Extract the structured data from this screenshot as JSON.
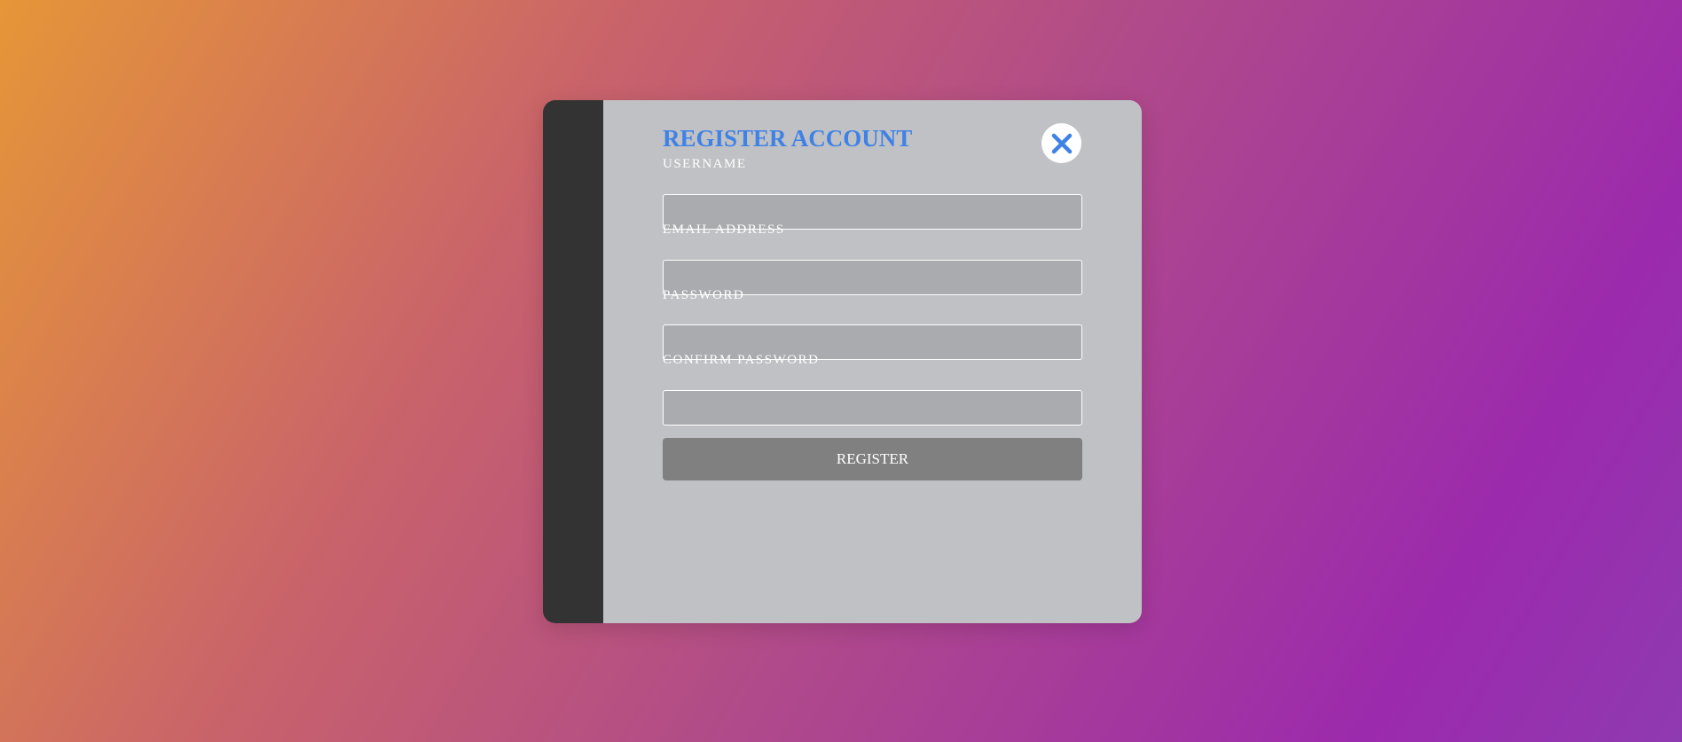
{
  "form": {
    "title": "REGISTER ACCOUNT",
    "fields": [
      {
        "label": "USERNAME",
        "value": "",
        "placeholder": ""
      },
      {
        "label": "EMAIL ADDRESS",
        "value": "",
        "placeholder": ""
      },
      {
        "label": "PASSWORD",
        "value": "",
        "placeholder": ""
      },
      {
        "label": "CONFIRM PASSWORD",
        "value": "",
        "placeholder": ""
      }
    ],
    "submit_label": "REGISTER",
    "close_icon": "close-icon"
  },
  "colors": {
    "accent": "#3f82e6",
    "sidebar": "#333333",
    "panel": "#c0c1c4",
    "input_bg": "#aaabae",
    "button_bg": "#808080"
  }
}
